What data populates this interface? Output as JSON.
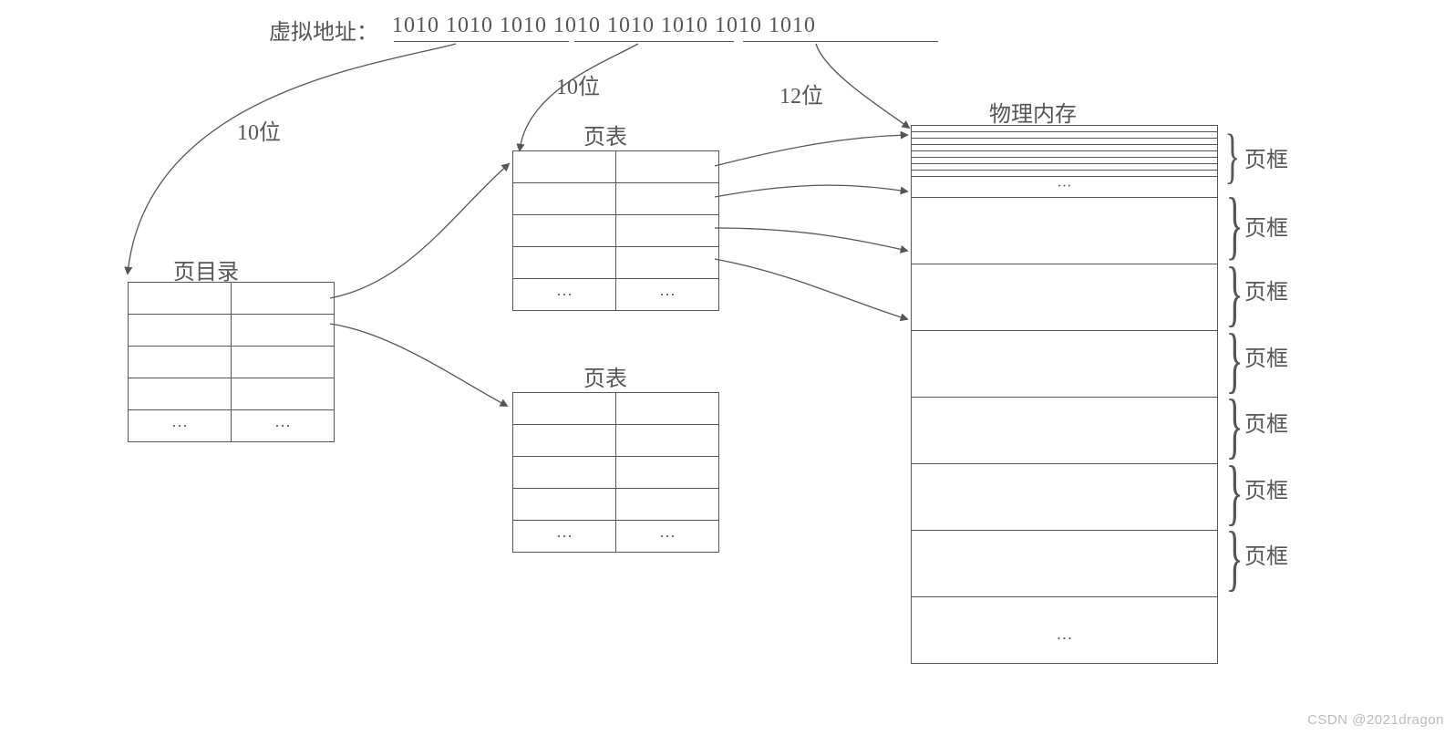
{
  "address": {
    "prefix": "虚拟地址：",
    "bits": "1010 1010 1010 1010 1010 1010 1010 1010",
    "seg1_label": "10位",
    "seg2_label": "10位",
    "seg3_label": "12位"
  },
  "page_directory": {
    "title": "页目录",
    "ellipsis": "···"
  },
  "page_table": {
    "title": "页表",
    "ellipsis": "···"
  },
  "physical_memory": {
    "title": "物理内存",
    "ellipsis": "···",
    "frame_label": "页框"
  },
  "watermark": "CSDN @2021dragon"
}
